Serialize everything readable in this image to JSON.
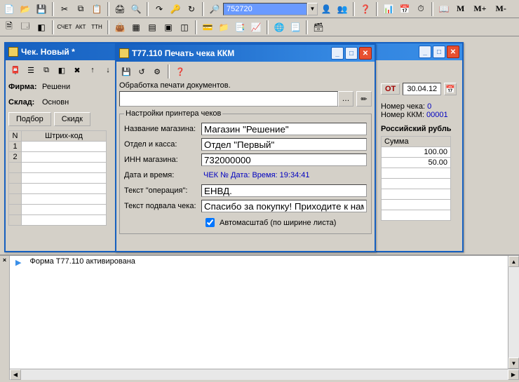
{
  "toolbar1": {
    "search_value": "752720",
    "m": "M",
    "mPlus": "M+",
    "mMinus": "M-"
  },
  "chekWindow": {
    "title": "Чек. Новый *",
    "firma_label": "Фирма:",
    "firma_value": "Решени",
    "sklad_label": "Склад:",
    "sklad_value": "Основн",
    "podbor_btn": "Подбор",
    "skidki_btn": "Скидк",
    "col_n": "N",
    "col_barcode": "Штрих-код",
    "rows": [
      "1",
      "2"
    ],
    "right": {
      "ot_label": "ОТ",
      "date": "30.04.12",
      "nomer_cheka_label": "Номер чека:",
      "nomer_cheka_value": "0",
      "nomer_kkm_label": "Номер ККМ:",
      "nomer_kkm_value": "00001",
      "currency": "Российский рубль",
      "col_sum": "Сумма",
      "sum1": "100.00",
      "sum2": "50.00"
    }
  },
  "dialog": {
    "title": "T77.110 Печать чека ККМ",
    "processing_label": "Обработка печати документов.",
    "fieldset_title": "Настройки принтера чеков",
    "store_name_label": "Название магазина:",
    "store_name_value": "Магазин \"Решение\"",
    "dept_label": "Отдел и касса:",
    "dept_value": "Отдел \"Первый\"",
    "inn_label": "ИНН магазина:",
    "inn_value": "732000000",
    "datetime_label": "Дата и время:",
    "datetime_value": "ЧЕК №  Дата:   Время: 19:34:41",
    "op_label": "Текст \"операция\":",
    "op_value": "ЕНВД.",
    "footer_label": "Текст подвала чека:",
    "footer_value": "Спасибо за покупку! Приходите к нам ещ",
    "autoscale_label": "Автомасштаб (по ширине листа)"
  },
  "statusbar": {
    "message": "Форма T77.110 активирована",
    "close_x": "×"
  }
}
